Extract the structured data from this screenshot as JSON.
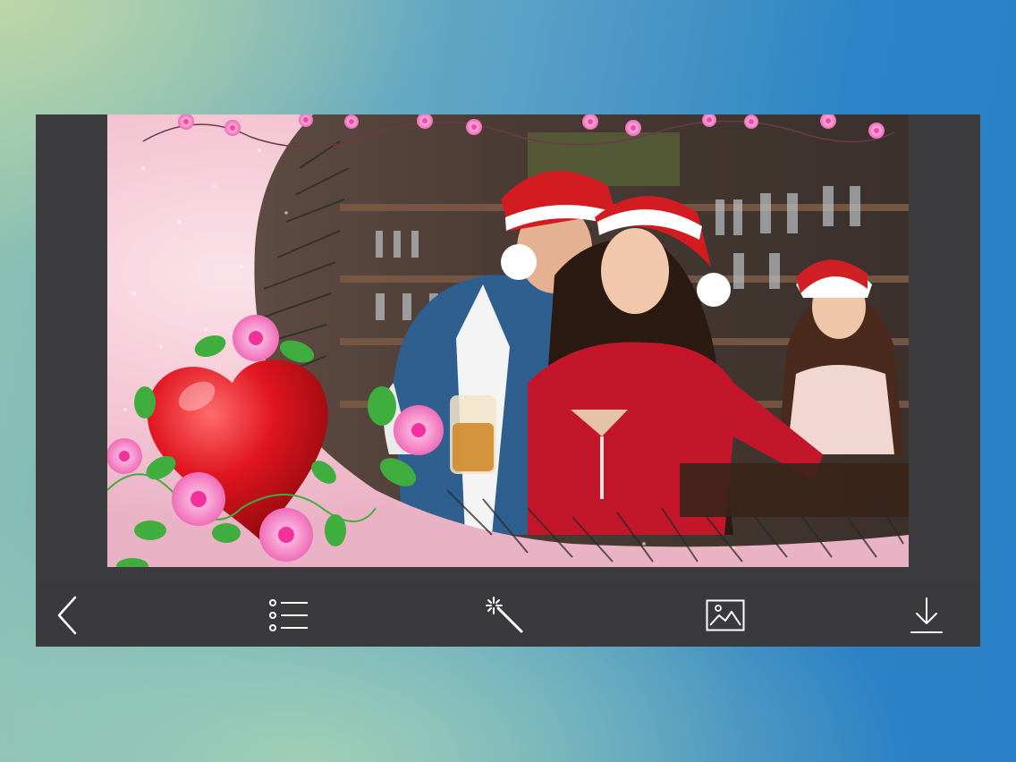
{
  "editor": {
    "photo_description_alt": "",
    "frame_style": "valentine-heart-pink-flowers"
  },
  "toolbar": {
    "items": [
      {
        "id": "back",
        "icon": "back-chevron-icon"
      },
      {
        "id": "frames",
        "icon": "list-icon"
      },
      {
        "id": "effects",
        "icon": "magic-wand-icon"
      },
      {
        "id": "gallery",
        "icon": "image-icon"
      },
      {
        "id": "save",
        "icon": "download-icon"
      }
    ]
  },
  "colors": {
    "frame_pink": "#f4c2d2",
    "heart_red": "#d9121c",
    "flower_pink": "#f27ac0",
    "leaf_green": "#3fae3f",
    "toolbar_bg": "#3a3a3c",
    "icon_white": "#ffffff"
  }
}
